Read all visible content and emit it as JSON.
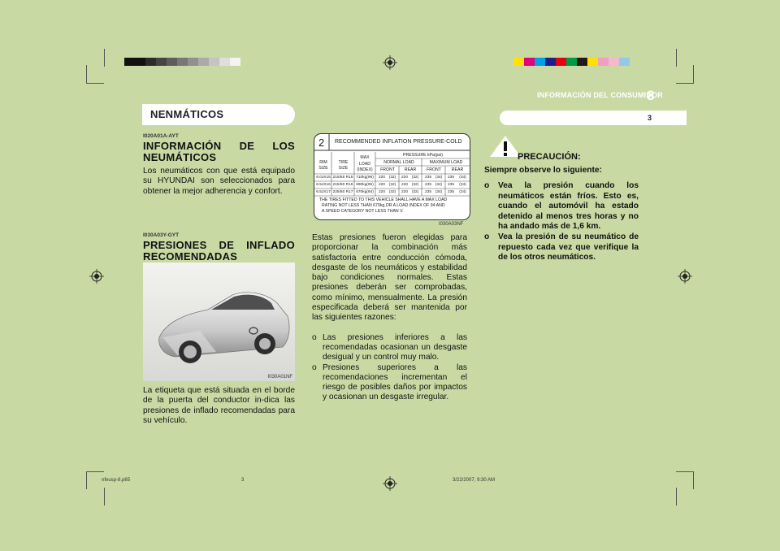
{
  "header": {
    "section_title": "INFORMACIÓN DEL CONSUMIDOR",
    "chapter_number": "8",
    "page_number": "3",
    "tab_label": "NENMÁTICOS"
  },
  "colors": {
    "page_bg": "#c8d9a3",
    "grayscale_bar": [
      "#111111",
      "#111111",
      "#2b2b2b",
      "#444444",
      "#5d5d5d",
      "#777777",
      "#909090",
      "#aaaaaa",
      "#c4c4c4",
      "#dedede",
      "#f3f3f3"
    ],
    "color_bar": [
      "#ffe100",
      "#e3007f",
      "#00a0e9",
      "#1d2088",
      "#e60012",
      "#009944",
      "#231815",
      "#ffe100",
      "#f19ec2",
      "#f5b8d0",
      "#92c8e8"
    ]
  },
  "section1": {
    "code": "I020A01A-AYT",
    "heading": "INFORMACIÓN DE LOS NEUMÁTICOS",
    "text": "Los neumáticos con que está equipado su HYUNDAI son seleccionados para obtener la mejor adherencia y confort."
  },
  "section2": {
    "code": "I030A03Y-GYT",
    "heading": "PRESIONES DE INFLADO RECOMENDADAS",
    "image_caption": "I030A01NF",
    "text": "La etiqueta  que está situada en el borde de la puerta del conductor in-dica las presiones de inflado recomendadas para su vehículo."
  },
  "tire_label": {
    "number": "2",
    "title": "RECOMMENDED INFLATION PRESSURE-COLD",
    "col_rim": "RIM\nSIZE",
    "col_tire": "TIRE\nSIZE",
    "col_load": "MAX\nLOAD\n(INDEX)",
    "pressure_header": "PRESSURE kPa(psi)",
    "normal_load": "NORMAL LOAD",
    "maximum_load": "MAXIMUM LOAD",
    "front": "FRONT",
    "rear": "REAR",
    "rows": [
      {
        "rim": "6.0JX15",
        "tire": "215/65 R15",
        "load": "710kg(96)",
        "nf": "220",
        "nfp": "(32)",
        "nr": "220",
        "nrp": "(32)",
        "mf": "235",
        "mfp": "(34)",
        "mr": "235",
        "mrp": "(34)"
      },
      {
        "rim": "6.5JX16",
        "tire": "215/60 R16",
        "load": "690kg(95)",
        "nf": "220",
        "nfp": "(32)",
        "nr": "220",
        "nrp": "(32)",
        "mf": "235",
        "mfp": "(34)",
        "mr": "235",
        "mrp": "(34)"
      },
      {
        "rim": "6.5JX17",
        "tire": "225/50 R17",
        "load": "670kg(94)",
        "nf": "220",
        "nfp": "(32)",
        "nr": "220",
        "nrp": "(32)",
        "mf": "235",
        "mfp": "(34)",
        "mr": "235",
        "mrp": "(34)"
      }
    ],
    "footer_line1": "THE TIRES FITTED TO THIS VEHICLE SHALL HAVE A MAX LOAD",
    "footer_line2": "RATING NOT LESS THAN 670kg,OR A LOAD INDEX OF 94 AND",
    "footer_line3": "A SPEED CATEGORY NOT LESS THAN V.",
    "caption": "I030A03NF"
  },
  "section3": {
    "intro": "Estas presiones fueron elegidas para proporcionar la combinación más satisfactoria entre conducción cómoda, desgaste de los neumáticos y estabilidad bajo condiciones normales. Estas presiones deberán ser comprobadas, como mínimo, mensualmente. La presión especificada deberá ser mantenida por las siguientes razones:",
    "bullets": [
      {
        "marker": "o",
        "text": "Las presiones inferiores a las recomendadas ocasionan un desgaste desigual y un control muy malo."
      },
      {
        "marker": "o",
        "text": "Presiones superiores a las recomendaciones incrementan el riesgo de posibles daños por impactos y ocasionan un desgaste irregular."
      }
    ]
  },
  "caution": {
    "icon": "warning-triangle-icon",
    "title": "PRECAUCIÓN:",
    "lead": "Siempre observe lo siguiente:",
    "items": [
      {
        "marker": "o",
        "text": "Vea la presión cuando los neumáticos están fríos. Esto es, cuando el automóvil ha estado detenido al menos tres horas y no ha andado  más de 1,6 km."
      },
      {
        "marker": "o",
        "text": "Vea la presión de su neumático de repuesto cada vez que verifique la de los otros neumáticos."
      }
    ]
  },
  "footer": {
    "file": "nfeusp-8.p65",
    "page": "3",
    "date": "3/22/2007, 9:30 AM"
  }
}
